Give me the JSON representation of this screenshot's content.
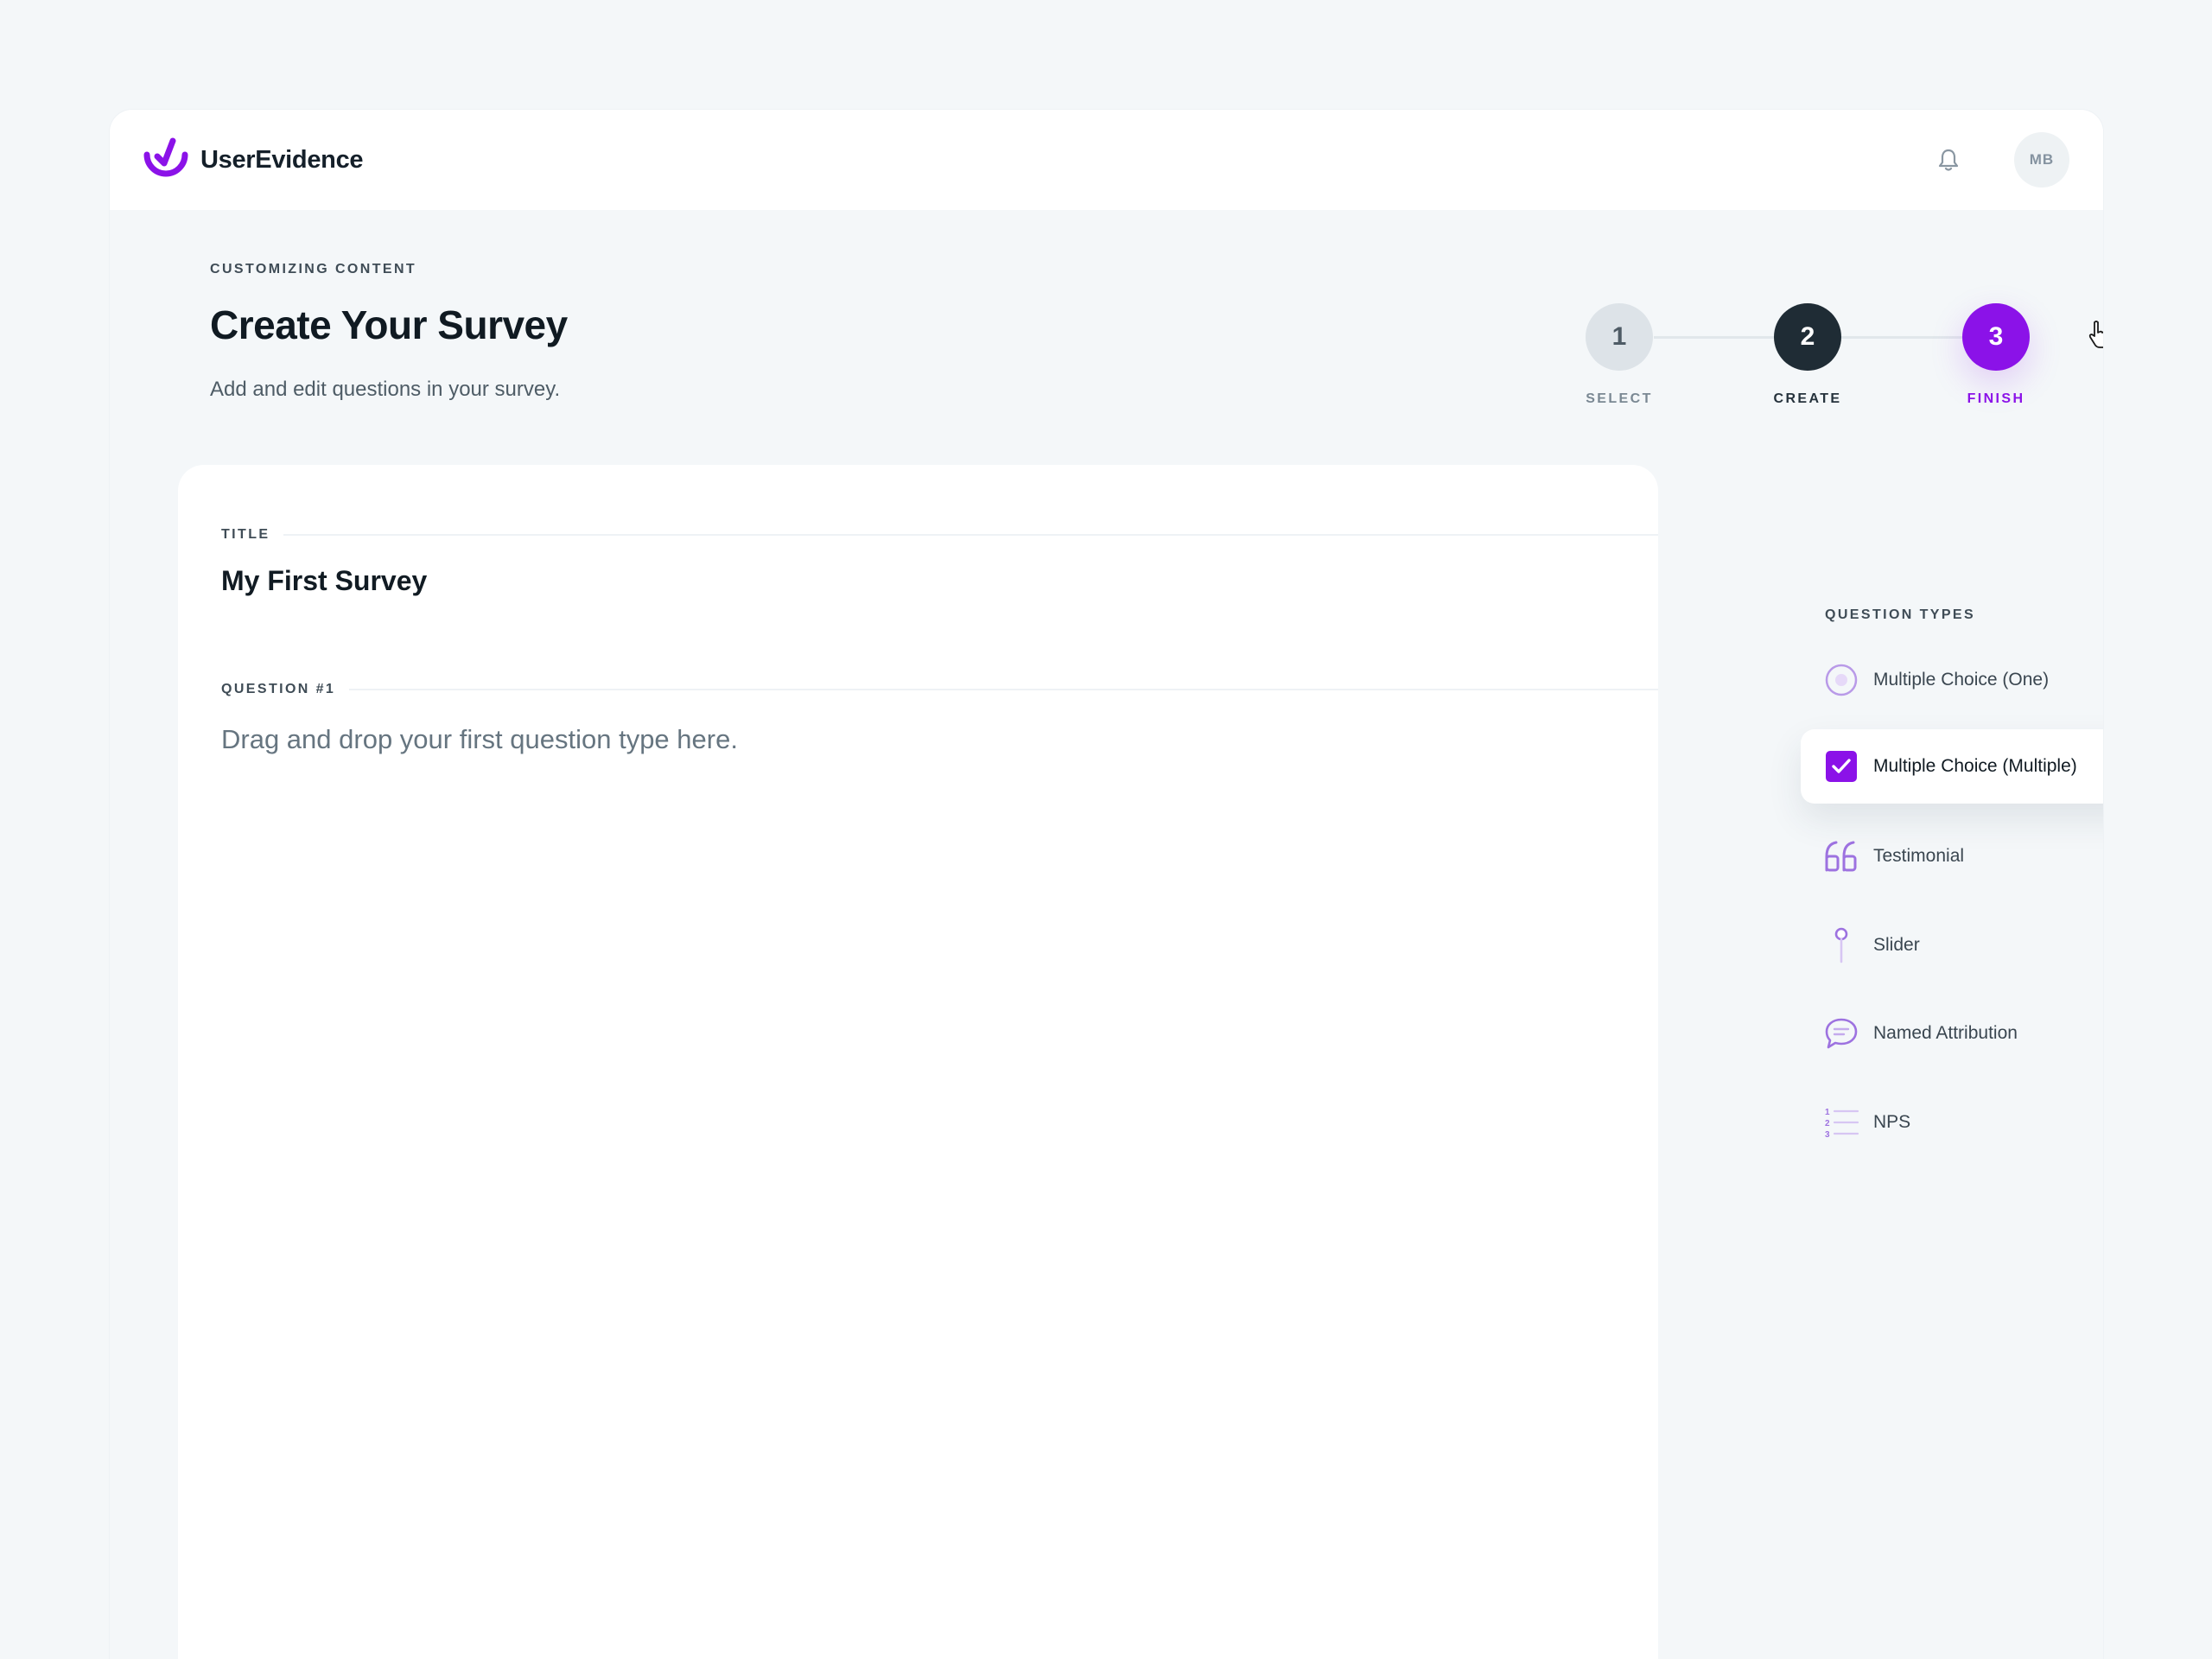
{
  "app": {
    "brand": "UserEvidence"
  },
  "header": {
    "avatar_initials": "MB"
  },
  "page": {
    "eyebrow": "CUSTOMIZING CONTENT",
    "title": "Create Your Survey",
    "subtitle": "Add and edit questions in your survey."
  },
  "stepper": {
    "steps": [
      {
        "number": "1",
        "label": "SELECT",
        "state": "done"
      },
      {
        "number": "2",
        "label": "CREATE",
        "state": "current"
      },
      {
        "number": "3",
        "label": "FINISH",
        "state": "hover"
      }
    ]
  },
  "editor": {
    "title_label": "TITLE",
    "title_value": "My First Survey",
    "question_label": "QUESTION #1",
    "question_placeholder": "Drag and drop your first question type here."
  },
  "sidebar": {
    "heading": "QUESTION TYPES",
    "items": [
      {
        "label": "Multiple Choice (One)",
        "icon": "radio-icon"
      },
      {
        "label": "Multiple Choice (Multiple)",
        "icon": "checkbox-icon",
        "active": true
      },
      {
        "label": "Testimonial",
        "icon": "quote-icon"
      },
      {
        "label": "Slider",
        "icon": "slider-icon"
      },
      {
        "label": "Named Attribution",
        "icon": "speech-bubble-icon"
      },
      {
        "label": "NPS",
        "icon": "numbered-list-icon"
      }
    ]
  },
  "colors": {
    "accent": "#8b12e8",
    "dark": "#1f2c35",
    "background": "#f4f7f9",
    "muted": "#7a8893"
  }
}
